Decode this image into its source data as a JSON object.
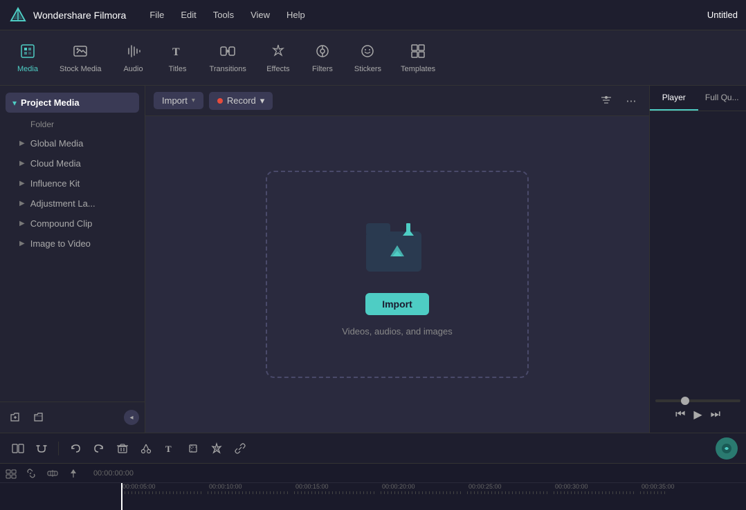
{
  "app": {
    "name": "Wondershare Filmora",
    "window_title": "Untitled"
  },
  "menu": {
    "items": [
      "File",
      "Edit",
      "Tools",
      "View",
      "Help"
    ]
  },
  "toolbar": {
    "items": [
      {
        "id": "media",
        "label": "Media",
        "icon": "⬛",
        "active": true
      },
      {
        "id": "stock-media",
        "label": "Stock Media",
        "icon": "🖼"
      },
      {
        "id": "audio",
        "label": "Audio",
        "icon": "♪"
      },
      {
        "id": "titles",
        "label": "Titles",
        "icon": "T"
      },
      {
        "id": "transitions",
        "label": "Transitions",
        "icon": "⇌"
      },
      {
        "id": "effects",
        "label": "Effects",
        "icon": "✦"
      },
      {
        "id": "filters",
        "label": "Filters",
        "icon": "⊙"
      },
      {
        "id": "stickers",
        "label": "Stickers",
        "icon": "☺"
      },
      {
        "id": "templates",
        "label": "Templates",
        "icon": "▦"
      }
    ]
  },
  "sidebar": {
    "header": {
      "label": "Project Media",
      "arrow": "▾"
    },
    "folder_label": "Folder",
    "items": [
      {
        "label": "Global Media",
        "has_arrow": true
      },
      {
        "label": "Cloud Media",
        "has_arrow": true
      },
      {
        "label": "Influence Kit",
        "has_arrow": true
      },
      {
        "label": "Adjustment La...",
        "has_arrow": true
      },
      {
        "label": "Compound Clip",
        "has_arrow": true
      },
      {
        "label": "Image to Video",
        "has_arrow": true
      }
    ],
    "bottom_buttons": {
      "add_folder": "＋",
      "folder_icon": "📁",
      "collapse_arrow": "◂"
    }
  },
  "content_toolbar": {
    "import_label": "Import",
    "record_label": "Record",
    "filter_icon": "≡",
    "more_icon": "⋯"
  },
  "import_zone": {
    "button_label": "Import",
    "subtitle": "Videos, audios, and images"
  },
  "player": {
    "tabs": [
      "Player",
      "Full Qu..."
    ],
    "active_tab": "Player"
  },
  "bottom_toolbar": {
    "buttons": [
      "⊞",
      "↺"
    ],
    "edit_buttons": [
      "↺",
      "↻",
      "🗑",
      "✂",
      "T",
      "▣",
      "✦₊",
      "🔗"
    ],
    "ai_icon": "●"
  },
  "timeline": {
    "header_buttons": [
      "⊞",
      "🔗",
      "↑↓",
      "♦"
    ],
    "time_offset": "00:00:00:00",
    "ruler_times": [
      "00:00:05:00",
      "00:00:10:00",
      "00:00:15:00",
      "00:00:20:00",
      "00:00:25:00",
      "00:00:30:00",
      "00:00:35:00"
    ]
  }
}
